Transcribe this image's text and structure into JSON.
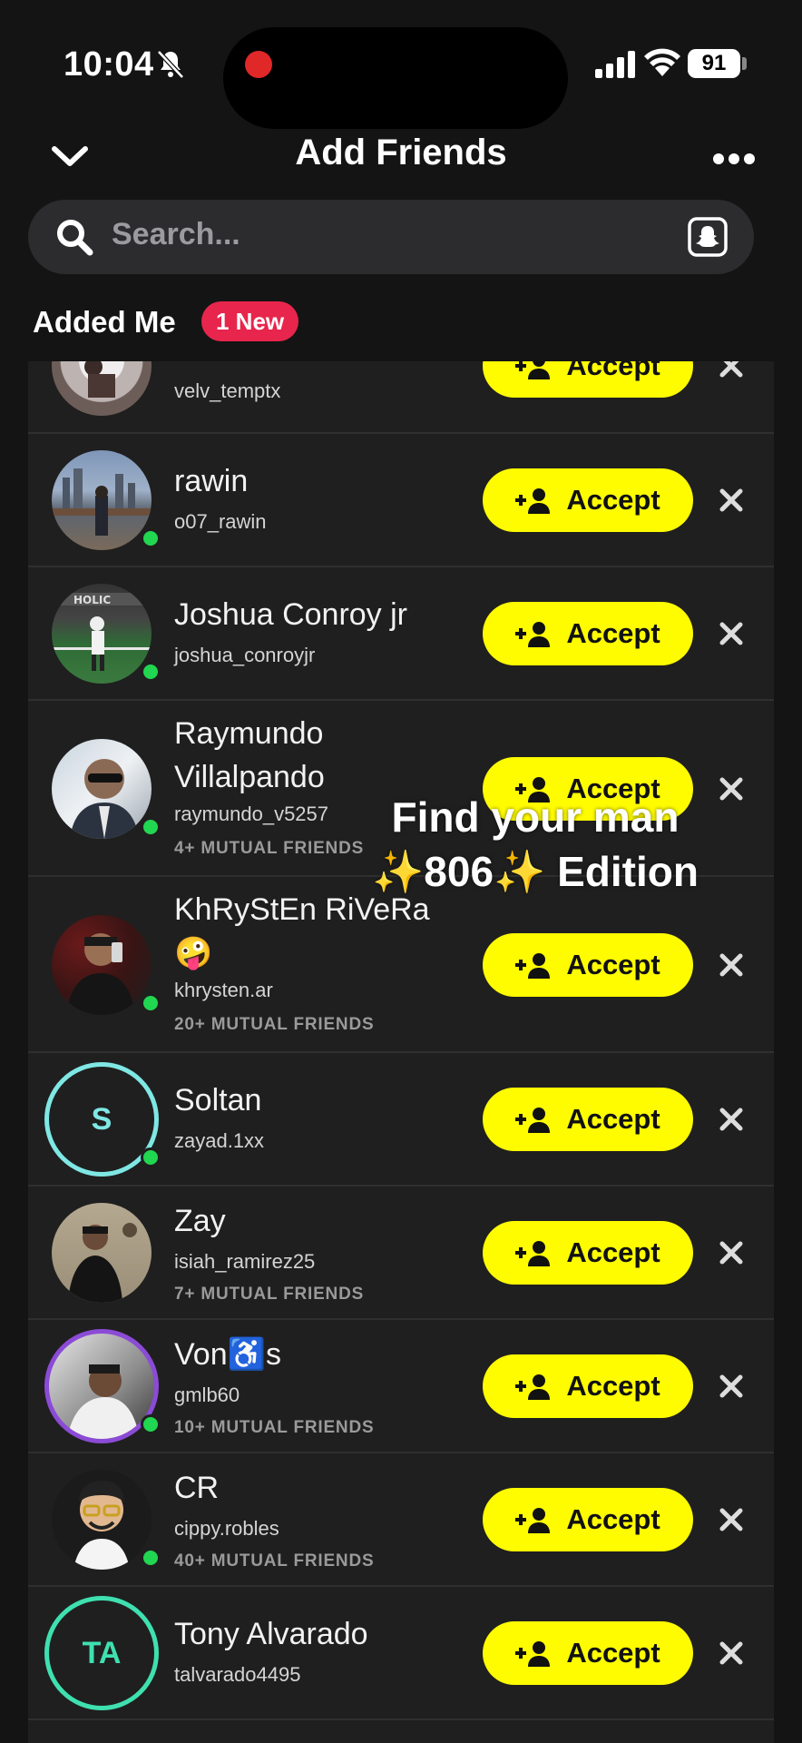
{
  "status": {
    "time": "10:04",
    "battery": "91"
  },
  "header": {
    "title": "Add Friends"
  },
  "search": {
    "placeholder": "Search..."
  },
  "section": {
    "label": "Added Me",
    "badge": "1 New"
  },
  "accept_label": "Accept",
  "overlay_text": "Find your man ✨806✨ Edition",
  "friends": [
    {
      "name": "",
      "username": "velv_temptx",
      "mutual": ""
    },
    {
      "name": "rawin",
      "username": "o07_rawin",
      "mutual": ""
    },
    {
      "name": "Joshua Conroy jr",
      "username": "joshua_conroyjr",
      "mutual": ""
    },
    {
      "name": "Raymundo Villalpando",
      "username": "raymundo_v5257",
      "mutual": "4+ MUTUAL FRIENDS"
    },
    {
      "name": "KhRyStEn RiVeRa 🤪",
      "username": "khrysten.ar",
      "mutual": "20+ MUTUAL FRIENDS"
    },
    {
      "name": "Soltan",
      "username": "zayad.1xx",
      "mutual": "",
      "initials": "S"
    },
    {
      "name": "Zay",
      "username": "isiah_ramirez25",
      "mutual": "7+ MUTUAL FRIENDS"
    },
    {
      "name": "Von♿️s",
      "username": "gmlb60",
      "mutual": "10+ MUTUAL FRIENDS"
    },
    {
      "name": "CR",
      "username": "cippy.robles",
      "mutual": "40+ MUTUAL FRIENDS"
    },
    {
      "name": "Tony Alvarado",
      "username": "talvarado4495",
      "mutual": "",
      "initials": "TA"
    }
  ]
}
